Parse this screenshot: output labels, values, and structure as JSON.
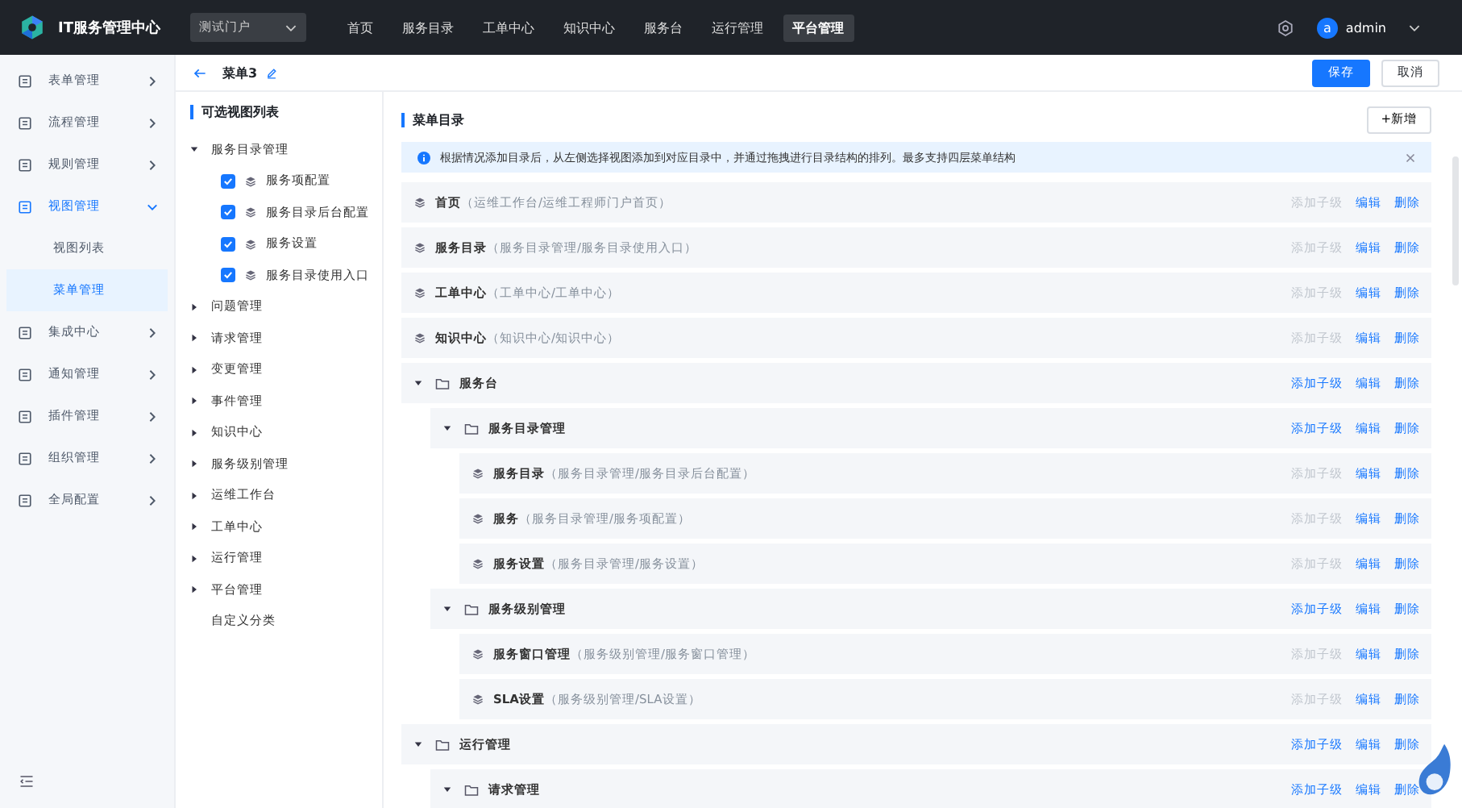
{
  "header": {
    "title": "IT服务管理中心",
    "portal_select": {
      "value": "测试门户"
    },
    "nav": [
      {
        "label": "首页",
        "selected": false
      },
      {
        "label": "服务目录",
        "selected": false
      },
      {
        "label": "工单中心",
        "selected": false
      },
      {
        "label": "知识中心",
        "selected": false
      },
      {
        "label": "服务台",
        "selected": false
      },
      {
        "label": "运行管理",
        "selected": false
      },
      {
        "label": "平台管理",
        "selected": true
      }
    ],
    "avatar": "a",
    "user": "admin"
  },
  "sidebar": {
    "items": [
      {
        "label": "表单管理",
        "expanded": false,
        "selected": false
      },
      {
        "label": "流程管理",
        "expanded": false,
        "selected": false
      },
      {
        "label": "规则管理",
        "expanded": false,
        "selected": false
      },
      {
        "label": "视图管理",
        "expanded": true,
        "selected": true,
        "children": [
          {
            "label": "视图列表",
            "selected": false
          },
          {
            "label": "菜单管理",
            "selected": true
          }
        ]
      },
      {
        "label": "集成中心",
        "expanded": false,
        "selected": false
      },
      {
        "label": "通知管理",
        "expanded": false,
        "selected": false
      },
      {
        "label": "插件管理",
        "expanded": false,
        "selected": false
      },
      {
        "label": "组织管理",
        "expanded": false,
        "selected": false
      },
      {
        "label": "全局配置",
        "expanded": false,
        "selected": false
      }
    ]
  },
  "page_header": {
    "title": "菜单3",
    "buttons": [
      {
        "label": "保存",
        "kind": "primary"
      },
      {
        "label": "取消",
        "kind": "default"
      }
    ]
  },
  "view_list": {
    "title": "可选视图列表",
    "items": [
      {
        "label": "服务目录管理",
        "kind": "group",
        "expanded": true,
        "children": [
          {
            "label": "服务项配置",
            "checked": true
          },
          {
            "label": "服务目录后台配置",
            "checked": true
          },
          {
            "label": "服务设置",
            "checked": true
          },
          {
            "label": "服务目录使用入口",
            "checked": true
          }
        ]
      },
      {
        "label": "问题管理",
        "kind": "group",
        "expanded": false
      },
      {
        "label": "请求管理",
        "kind": "group",
        "expanded": false
      },
      {
        "label": "变更管理",
        "kind": "group",
        "expanded": false
      },
      {
        "label": "事件管理",
        "kind": "group",
        "expanded": false
      },
      {
        "label": "知识中心",
        "kind": "group",
        "expanded": false
      },
      {
        "label": "服务级别管理",
        "kind": "group",
        "expanded": false
      },
      {
        "label": "运维工作台",
        "kind": "group",
        "expanded": false
      },
      {
        "label": "工单中心",
        "kind": "group",
        "expanded": false
      },
      {
        "label": "运行管理",
        "kind": "group",
        "expanded": false
      },
      {
        "label": "平台管理",
        "kind": "group",
        "expanded": false
      },
      {
        "label": "自定义分类",
        "kind": "custom"
      }
    ]
  },
  "menu_catalog": {
    "title": "菜单目录",
    "add_button": "+新增",
    "notice": "根据情况添加目录后，从左侧选择视图添加到对应目录中，并通过拖拽进行目录结构的排列。最多支持四层菜单结构",
    "items": [
      {
        "kind": "view",
        "name": "首页",
        "path": "（运维工作台/运维工程师门户首页）",
        "actions": [
          {
            "label": "添加子级",
            "disabled": true
          },
          {
            "label": "编辑",
            "disabled": false
          },
          {
            "label": "删除",
            "disabled": false
          }
        ]
      },
      {
        "kind": "view",
        "name": "服务目录",
        "path": "（服务目录管理/服务目录使用入口）",
        "actions": [
          {
            "label": "添加子级",
            "disabled": true
          },
          {
            "label": "编辑",
            "disabled": false
          },
          {
            "label": "删除",
            "disabled": false
          }
        ]
      },
      {
        "kind": "view",
        "name": "工单中心",
        "path": "（工单中心/工单中心）",
        "actions": [
          {
            "label": "添加子级",
            "disabled": true
          },
          {
            "label": "编辑",
            "disabled": false
          },
          {
            "label": "删除",
            "disabled": false
          }
        ]
      },
      {
        "kind": "view",
        "name": "知识中心",
        "path": "（知识中心/知识中心）",
        "actions": [
          {
            "label": "添加子级",
            "disabled": true
          },
          {
            "label": "编辑",
            "disabled": false
          },
          {
            "label": "删除",
            "disabled": false
          }
        ]
      },
      {
        "kind": "folder",
        "name": "服务台",
        "expanded": true,
        "actions": [
          {
            "label": "添加子级",
            "disabled": false
          },
          {
            "label": "编辑",
            "disabled": false
          },
          {
            "label": "删除",
            "disabled": false
          }
        ],
        "children": [
          {
            "kind": "folder",
            "name": "服务目录管理",
            "expanded": true,
            "actions": [
              {
                "label": "添加子级",
                "disabled": false
              },
              {
                "label": "编辑",
                "disabled": false
              },
              {
                "label": "删除",
                "disabled": false
              }
            ],
            "children": [
              {
                "kind": "view",
                "name": "服务目录",
                "path": "（服务目录管理/服务目录后台配置）",
                "actions": [
                  {
                    "label": "添加子级",
                    "disabled": true
                  },
                  {
                    "label": "编辑",
                    "disabled": false
                  },
                  {
                    "label": "删除",
                    "disabled": false
                  }
                ]
              },
              {
                "kind": "view",
                "name": "服务",
                "path": "（服务目录管理/服务项配置）",
                "actions": [
                  {
                    "label": "添加子级",
                    "disabled": true
                  },
                  {
                    "label": "编辑",
                    "disabled": false
                  },
                  {
                    "label": "删除",
                    "disabled": false
                  }
                ]
              },
              {
                "kind": "view",
                "name": "服务设置",
                "path": "（服务目录管理/服务设置）",
                "actions": [
                  {
                    "label": "添加子级",
                    "disabled": true
                  },
                  {
                    "label": "编辑",
                    "disabled": false
                  },
                  {
                    "label": "删除",
                    "disabled": false
                  }
                ]
              }
            ]
          },
          {
            "kind": "folder",
            "name": "服务级别管理",
            "expanded": true,
            "actions": [
              {
                "label": "添加子级",
                "disabled": false
              },
              {
                "label": "编辑",
                "disabled": false
              },
              {
                "label": "删除",
                "disabled": false
              }
            ],
            "children": [
              {
                "kind": "view",
                "name": "服务窗口管理",
                "path": "（服务级别管理/服务窗口管理）",
                "actions": [
                  {
                    "label": "添加子级",
                    "disabled": true
                  },
                  {
                    "label": "编辑",
                    "disabled": false
                  },
                  {
                    "label": "删除",
                    "disabled": false
                  }
                ]
              },
              {
                "kind": "view",
                "name": "SLA设置",
                "path": "（服务级别管理/SLA设置）",
                "actions": [
                  {
                    "label": "添加子级",
                    "disabled": true
                  },
                  {
                    "label": "编辑",
                    "disabled": false
                  },
                  {
                    "label": "删除",
                    "disabled": false
                  }
                ]
              }
            ]
          }
        ]
      },
      {
        "kind": "folder",
        "name": "运行管理",
        "expanded": true,
        "actions": [
          {
            "label": "添加子级",
            "disabled": false
          },
          {
            "label": "编辑",
            "disabled": false
          },
          {
            "label": "删除",
            "disabled": false
          }
        ],
        "children": [
          {
            "kind": "folder",
            "name": "请求管理",
            "expanded": true,
            "actions": [
              {
                "label": "添加子级",
                "disabled": false
              },
              {
                "label": "编辑",
                "disabled": false
              },
              {
                "label": "删除",
                "disabled": false
              }
            ]
          }
        ]
      }
    ]
  }
}
